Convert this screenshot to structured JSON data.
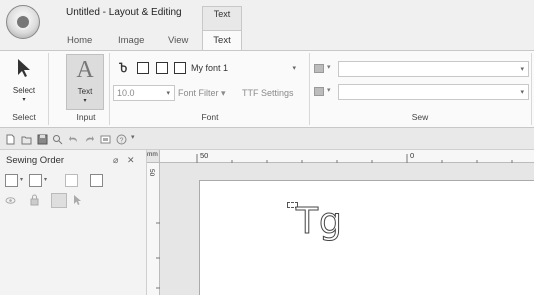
{
  "titlebar": {
    "title": "Untitled - Layout & Editing",
    "context_tab": "Text"
  },
  "ribbon_tabs": [
    "Home",
    "Image",
    "View",
    "Text"
  ],
  "ribbon": {
    "select_group": {
      "button_label": "Select",
      "group_label": "Select"
    },
    "input_group": {
      "button_label": "Text",
      "group_label": "Input"
    },
    "font_group": {
      "font_name": "My font 1",
      "font_size": "10.0",
      "font_filter_label": "Font Filter",
      "ttf_settings_label": "TTF Settings",
      "group_label": "Font"
    },
    "sew_group": {
      "group_label": "Sew"
    }
  },
  "sewing_order_panel": {
    "title": "Sewing Order",
    "pin_glyph": "⌀",
    "close_glyph": "✕"
  },
  "ruler": {
    "unit": "mm",
    "h_label_50": "50",
    "h_label_0": "0",
    "v_label_50": "50"
  },
  "canvas": {
    "sample_text": "Tg"
  },
  "icons": {
    "select": "cursor-arrow-icon",
    "text": "letter-a-icon",
    "font_type": "truetype-font-icon"
  }
}
